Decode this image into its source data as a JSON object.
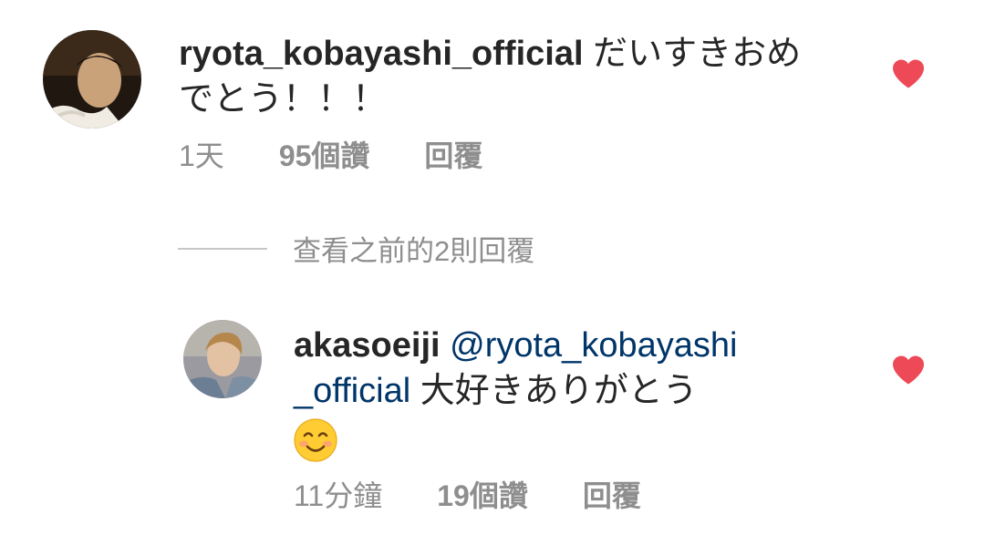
{
  "comment1": {
    "username": "ryota_kobayashi_official",
    "text_line1": "だいすきおめ",
    "text_line2": "でとう！！！",
    "time": "1天",
    "likes": "95個讚",
    "reply": "回覆",
    "liked": true
  },
  "view_replies": {
    "label": "查看之前的2則回覆"
  },
  "comment2": {
    "username": "akasoeiji",
    "mention_line1": "@ryota_kobayashi",
    "mention_line2": "_official",
    "text": "大好きありがとう",
    "emoji": "smiling-face-icon",
    "time": "11分鐘",
    "likes": "19個讚",
    "reply": "回覆",
    "liked": true
  },
  "colors": {
    "heart": "#ed4956",
    "mention": "#003569",
    "meta": "#8e8e8e"
  }
}
